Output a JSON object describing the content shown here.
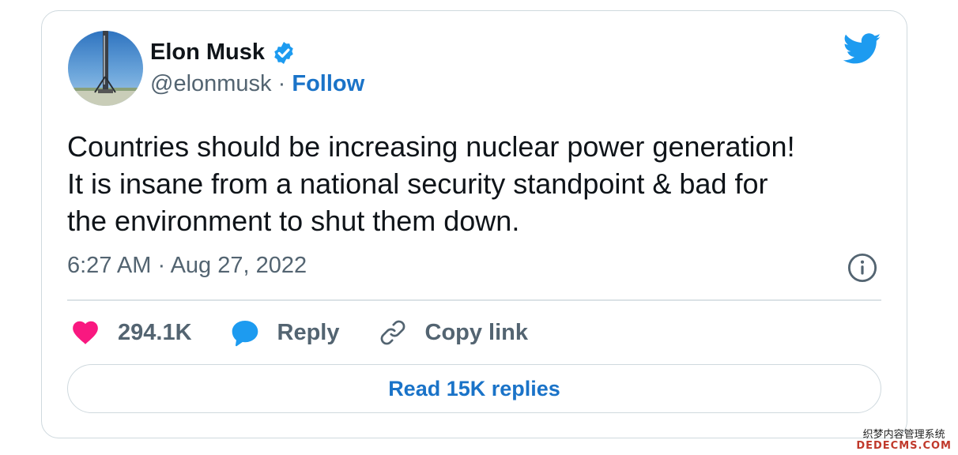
{
  "tweet": {
    "author_name": "Elon Musk",
    "author_handle": "@elonmusk",
    "separator": "·",
    "follow_label": "Follow",
    "text_lines": [
      "Countries should be increasing nuclear power generation!",
      "It is insane from a national security standpoint & bad for",
      "the environment to shut them down."
    ],
    "timestamp": "6:27 AM · Aug 27, 2022",
    "likes": "294.1K",
    "reply_label": "Reply",
    "copy_link_label": "Copy link",
    "read_replies_label": "Read 15K replies"
  },
  "icons": {
    "avatar": "rocket-photo",
    "verified": "verified-badge-icon",
    "logo": "twitter-bird-icon",
    "info": "info-icon",
    "like": "heart-icon",
    "reply": "speech-bubble-icon",
    "link": "link-icon"
  },
  "colors": {
    "accent": "#1d9bf0",
    "link_text": "#1a73c8",
    "like": "#f91880",
    "muted": "#536471"
  },
  "watermark": {
    "line1": "织梦内容管理系统",
    "line2": "DEDECMS.COM"
  }
}
